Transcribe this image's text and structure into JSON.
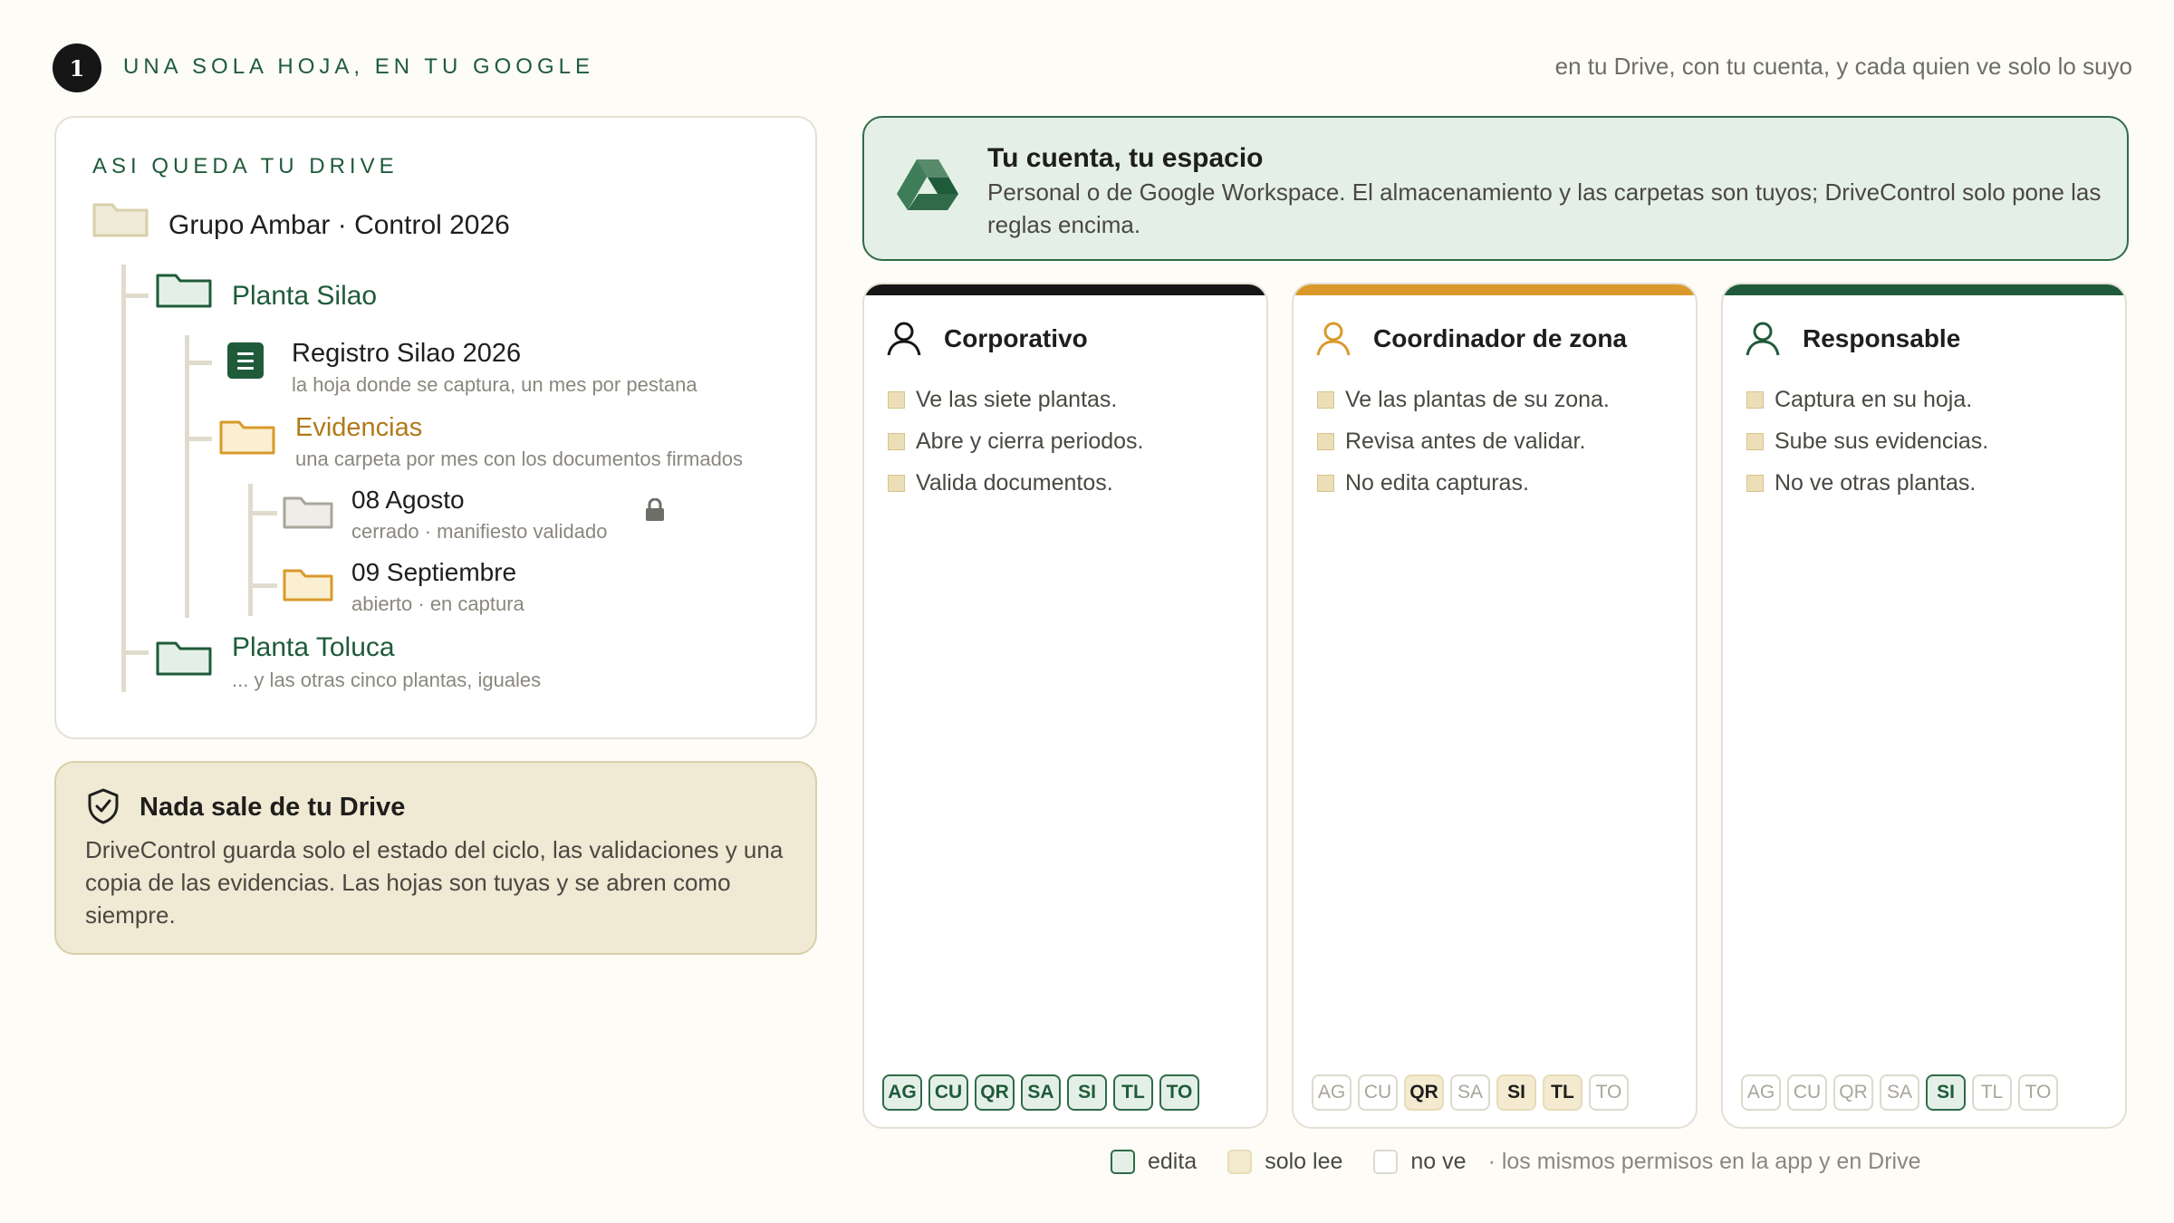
{
  "header": {
    "step_number": "1",
    "title": "UNA SOLA HOJA, EN TU GOOGLE",
    "subtitle": "en tu Drive, con tu cuenta, y cada quien ve solo lo suyo"
  },
  "drive": {
    "label": "ASI QUEDA TU DRIVE",
    "root": "Grupo Ambar · Control 2026",
    "plant_1": "Planta Silao",
    "registro_name": "Registro Silao 2026",
    "registro_desc": "la hoja donde se captura, un mes por pestana",
    "evidencias_name": "Evidencias",
    "evidencias_desc": "una carpeta por mes con los documentos firmados",
    "month_1_name": "08 Agosto",
    "month_1_desc": "cerrado · manifiesto validado",
    "month_2_name": "09 Septiembre",
    "month_2_desc": "abierto · en captura",
    "plant_2": "Planta Toluca",
    "plant_2_desc": "... y las otras cinco plantas, iguales"
  },
  "notice": {
    "title": "Nada sale de tu Drive",
    "body": "DriveControl guarda solo el estado del ciclo, las validaciones y una copia de las evidencias. Las hojas son tuyas y se abren como siempre."
  },
  "account": {
    "title": "Tu cuenta, tu espacio",
    "body": "Personal o de Google Workspace. El almacenamiento y las carpetas son tuyos; DriveControl solo pone las reglas encima."
  },
  "roles": [
    {
      "title": "Corporativo",
      "accent": "#161616",
      "items": [
        "Ve las siete plantas.",
        "Abre y cierra periodos.",
        "Valida documentos."
      ],
      "chips": [
        "AG",
        "CU",
        "QR",
        "SA",
        "SI",
        "TL",
        "TO"
      ]
    },
    {
      "title": "Coordinador de zona",
      "accent": "#d99a2b",
      "items": [
        "Ve las plantas de su zona.",
        "Revisa antes de validar.",
        "No edita capturas."
      ],
      "chips": [
        "AG",
        "CU",
        "QR",
        "SA",
        "SI",
        "TL",
        "TO"
      ]
    },
    {
      "title": "Responsable",
      "accent": "#1f5b3a",
      "items": [
        "Captura en su hoja.",
        "Sube sus evidencias.",
        "No ve otras plantas."
      ],
      "chips": [
        "AG",
        "CU",
        "QR",
        "SA",
        "SI",
        "TL",
        "TO"
      ]
    }
  ],
  "chip_access": [
    [
      "edit",
      "edit",
      "edit",
      "edit",
      "edit",
      "edit",
      "edit"
    ],
    [
      "none",
      "none",
      "read",
      "none",
      "read",
      "read",
      "none"
    ],
    [
      "none",
      "none",
      "none",
      "none",
      "edit",
      "none",
      "none"
    ]
  ],
  "legend": {
    "edit": "edita",
    "read": "solo lee",
    "none": "no ve",
    "note": "· los mismos permisos en la app y en Drive"
  },
  "colors": {
    "brand_green": "#1f5b3a",
    "amber": "#d99a2b",
    "paper": "#f0e9d3"
  }
}
